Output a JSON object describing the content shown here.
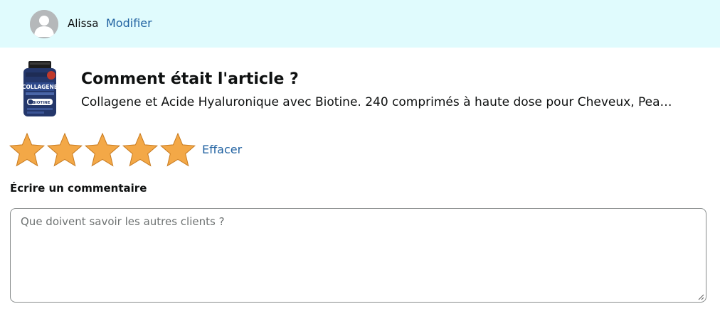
{
  "user": {
    "name": "Alissa",
    "edit_label": "Modifier"
  },
  "product": {
    "question": "Comment était l'article ?",
    "name": "Collagene et Acide Hyaluronique avec Biotine. 240 comprimés à haute dose pour Cheveux, Pea…",
    "thumbnail_label": "COLLAGENE",
    "thumbnail_sublabel": "BIOTINE"
  },
  "rating": {
    "value": 5,
    "max": 5,
    "clear_label": "Effacer",
    "star_color": "#f3a847"
  },
  "comment": {
    "label": "Écrire un commentaire",
    "placeholder": "Que doivent savoir les autres clients ?"
  },
  "colors": {
    "header_bg": "#e0fbfd",
    "link": "#2162a1"
  }
}
